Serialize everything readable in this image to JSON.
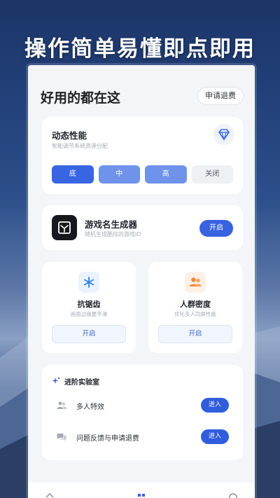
{
  "headline": "操作简单易懂即点即用",
  "page": {
    "title": "好用的都在这",
    "refund_button": "申请退费"
  },
  "performance": {
    "title": "动态性能",
    "subtitle": "智能调节系统资源分配",
    "icon": "diamond-icon",
    "options": [
      "底",
      "中",
      "高",
      "关闭"
    ],
    "selected": "底"
  },
  "generator": {
    "title": "游戏名生成器",
    "subtitle": "随机生成酷炫的游戏ID",
    "button": "开启",
    "icon": "box-logo-icon"
  },
  "anti_alias": {
    "title": "抗锯齿",
    "subtitle": "画面边缘更平滑",
    "button": "开启",
    "icon": "snowflake-icon",
    "icon_color": "#2f80ed"
  },
  "crowd": {
    "title": "人群密度",
    "subtitle": "优化多人同屏性能",
    "button": "开启",
    "icon": "people-icon",
    "icon_color": "#f08a3c"
  },
  "lab": {
    "title": "进阶实验室",
    "icon": "sparkle-icon",
    "items": [
      {
        "label": "多人特效",
        "button": "进入",
        "icon": "people-icon"
      },
      {
        "label": "问题反馈与申请退费",
        "button": "进入",
        "icon": "chat-icon"
      }
    ]
  },
  "colors": {
    "accent": "#3763e0",
    "accent_light": "#6f92ea"
  }
}
